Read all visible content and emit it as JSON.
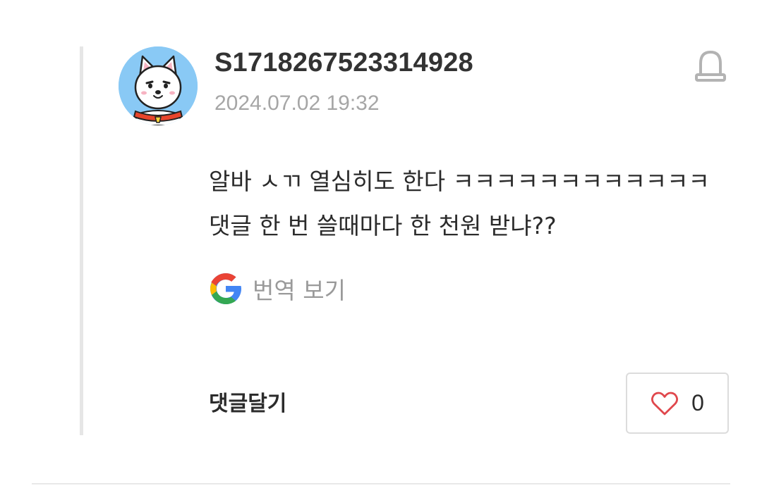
{
  "comment": {
    "author": "S1718267523314928",
    "timestamp": "2024.07.02 19:32",
    "text": "알바 ㅅㄲ 열심히도 한다 ㅋㅋㅋㅋㅋㅋㅋㅋㅋㅋㅋㅋ댓글 한 번 쓸때마다 한 천원 받냐??",
    "translate_label": "번역 보기",
    "reply_label": "댓글달기",
    "like_count": "0",
    "icons": {
      "avatar": "dog-avatar-icon",
      "report": "siren-icon",
      "translate": "google-g-icon",
      "like": "heart-outline-icon"
    }
  }
}
